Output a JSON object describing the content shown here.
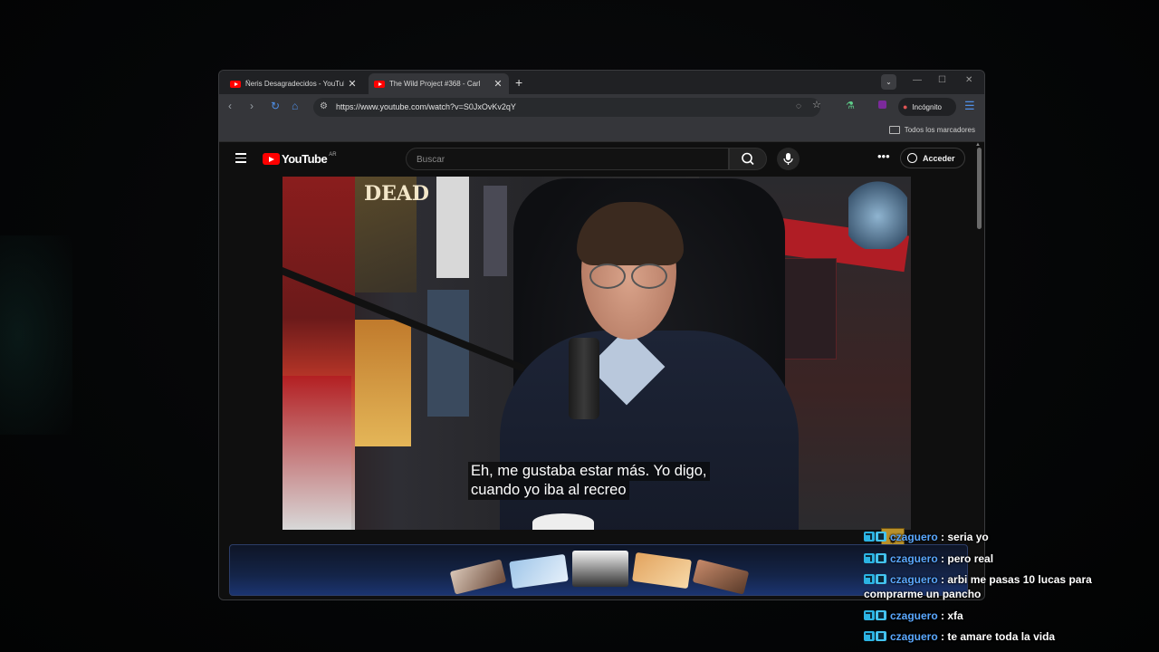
{
  "browser": {
    "tabs": [
      {
        "title": "Ñeris Desagradecidos - YouTube",
        "active": false
      },
      {
        "title": "The Wild Project #368 - Carl",
        "active": true
      }
    ],
    "new_tab_symbol": "+",
    "close_symbol": "✕",
    "url": "https://www.youtube.com/watch?v=S0JxOvKv2qY",
    "incognito_label": "Incógnito",
    "bookmarks_all_label": "Todos los marcadores"
  },
  "youtube": {
    "logo_text": "YouTube",
    "country_code": "AR",
    "search_placeholder": "Buscar",
    "signin_label": "Acceder",
    "more_symbol": "•••"
  },
  "video": {
    "subtitle_line1": "Eh, me gustaba estar más. Yo digo,",
    "subtitle_line2": "cuando yo iba al recreo",
    "poster_text": "DEAD"
  },
  "chat": [
    {
      "user": "czaguero",
      "message": "seria yo"
    },
    {
      "user": "czaguero",
      "message": "pero real"
    },
    {
      "user": "czaguero",
      "message": "arbi me pasas 10 lucas para comprarme un pancho"
    },
    {
      "user": "czaguero",
      "message": "xfa"
    },
    {
      "user": "czaguero",
      "message": "te amare toda la vida"
    }
  ],
  "colors": {
    "youtube_red": "#ff0000",
    "chat_username": "#5aa8ff",
    "badge_cyan": "#2bb3e3"
  }
}
